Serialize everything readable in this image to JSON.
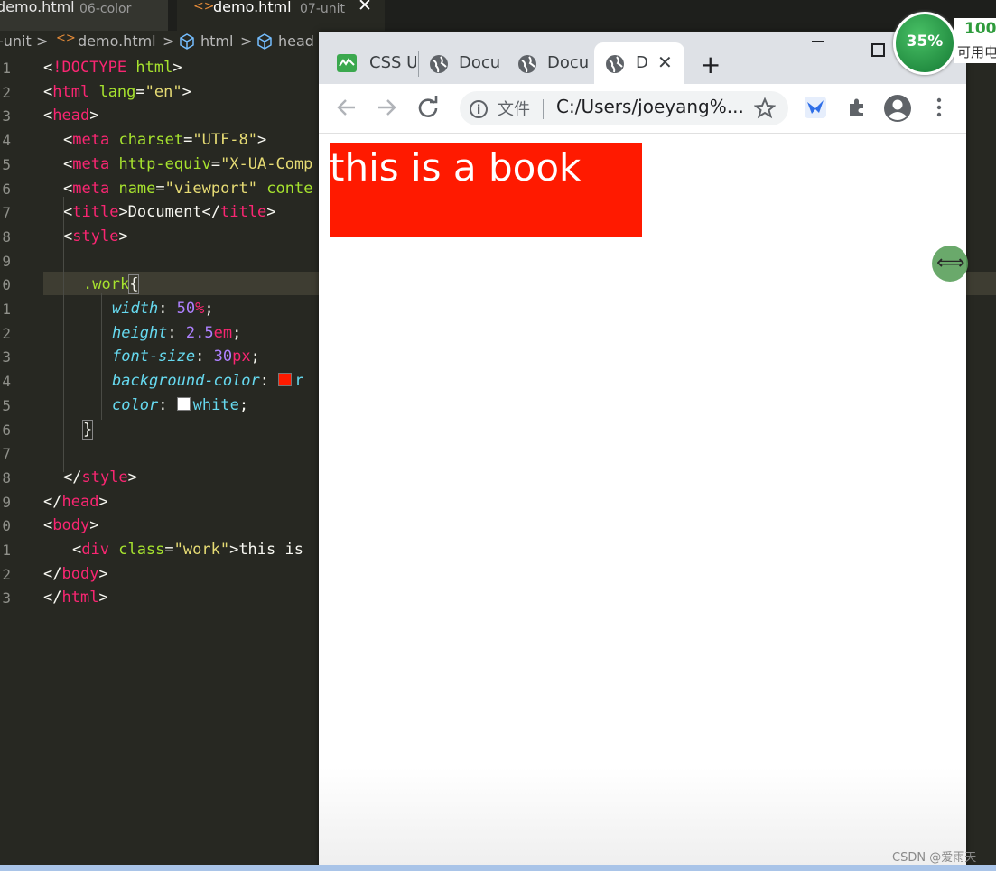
{
  "editor": {
    "tabs": [
      {
        "name": "demo.html",
        "folder": "06-color"
      },
      {
        "name": "demo.html",
        "folder": "07-unit",
        "close": "✕"
      }
    ],
    "breadcrumbs": [
      "-unit",
      ">",
      "demo.html",
      ">",
      "html",
      ">",
      "head"
    ],
    "line_numbers": [
      "1",
      "2",
      "3",
      "4",
      "5",
      "6",
      "7",
      "8",
      "9",
      "0",
      "1",
      "2",
      "3",
      "4",
      "5",
      "6",
      "7",
      "8",
      "9",
      "0",
      "1",
      "2",
      "3"
    ]
  },
  "browser": {
    "tabs": [
      "CSS U",
      "Docu",
      "Docu",
      "D"
    ],
    "tab_close": "✕",
    "new_tab": "+",
    "address": {
      "scheme_label": "文件",
      "url": "C:/Users/joeyang%..."
    },
    "page": {
      "div_text": "this is a book",
      "div_bg": "#ff1a00",
      "div_color": "#ffffff"
    }
  },
  "overlay": {
    "meter_value": "35%",
    "meter_side_top": "100",
    "meter_side_bottom": "可用电",
    "watermark": "CSDN @爱雨天"
  },
  "colors": {
    "tag": "#f92672",
    "attr": "#a6e22e",
    "string": "#e6db74",
    "property": "#66d9ef",
    "number": "#ae81ff"
  }
}
